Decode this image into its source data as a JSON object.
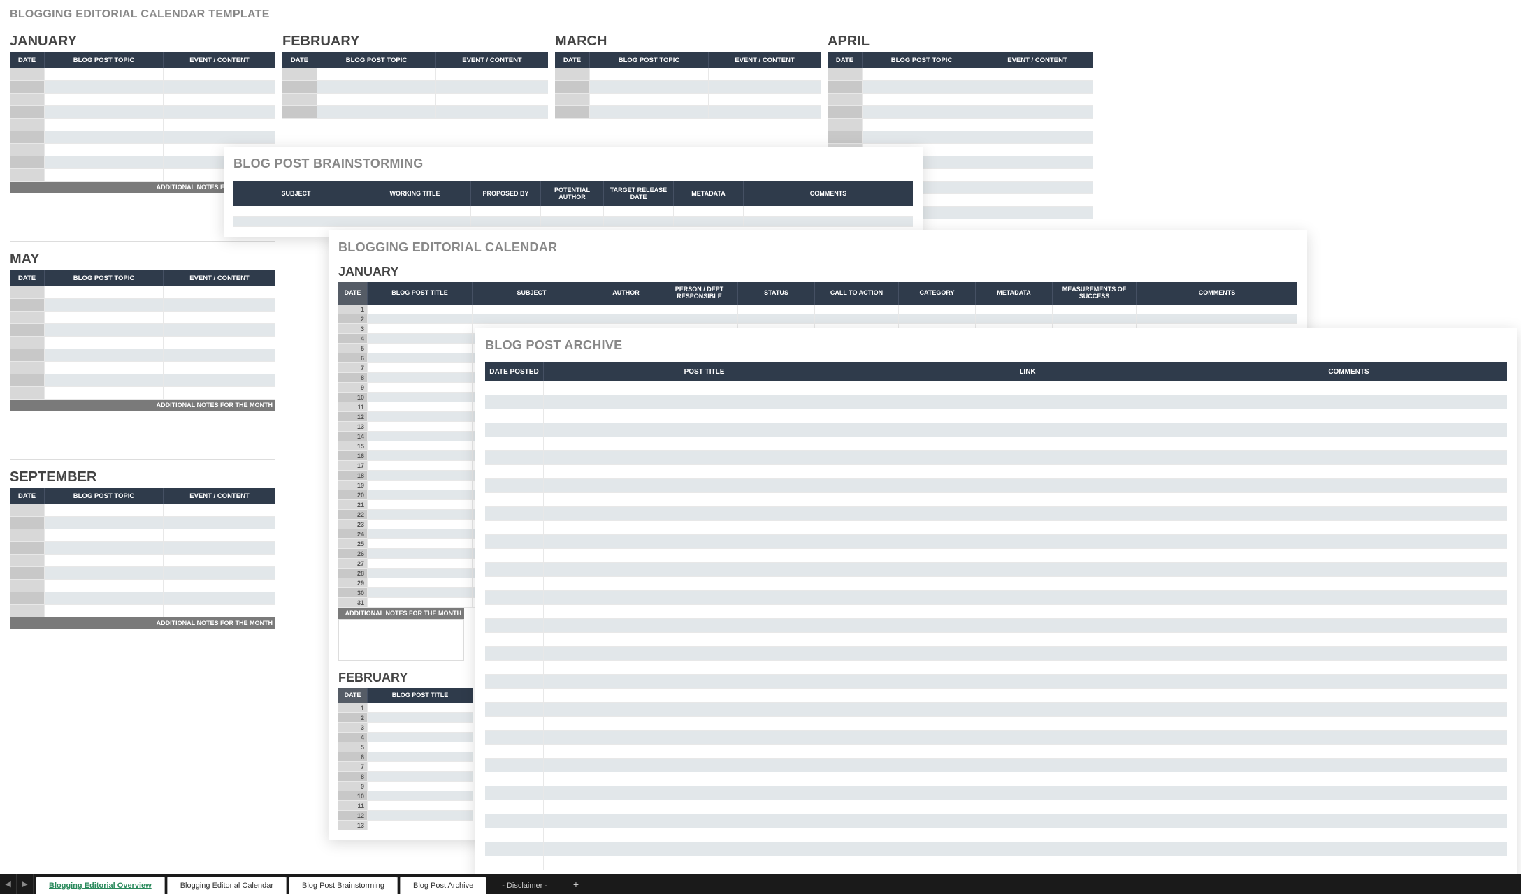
{
  "layer1": {
    "title": "BLOGGING EDITORIAL CALENDAR TEMPLATE",
    "columns": [
      "DATE",
      "BLOG POST TOPIC",
      "EVENT / CONTENT"
    ],
    "notes_label": "ADDITIONAL NOTES FOR THE MONTH",
    "months_row1": [
      "JANUARY",
      "FEBRUARY",
      "MARCH",
      "APRIL"
    ],
    "months_row2": [
      "MAY"
    ],
    "months_row3": [
      "SEPTEMBER"
    ]
  },
  "layer2": {
    "title": "BLOG POST BRAINSTORMING",
    "columns": [
      "SUBJECT",
      "WORKING TITLE",
      "PROPOSED BY",
      "POTENTIAL AUTHOR",
      "TARGET RELEASE DATE",
      "METADATA",
      "COMMENTS"
    ]
  },
  "layer3": {
    "title": "BLOGGING EDITORIAL CALENDAR",
    "month1": "JANUARY",
    "month2": "FEBRUARY",
    "columns": [
      "DATE",
      "BLOG POST TITLE",
      "SUBJECT",
      "AUTHOR",
      "PERSON / DEPT RESPONSIBLE",
      "STATUS",
      "CALL TO ACTION",
      "CATEGORY",
      "METADATA",
      "MEASUREMENTS OF SUCCESS",
      "COMMENTS"
    ],
    "notes_label": "ADDITIONAL NOTES FOR THE MONTH"
  },
  "layer4": {
    "title": "BLOG POST ARCHIVE",
    "columns": [
      "DATE POSTED",
      "POST TITLE",
      "LINK",
      "COMMENTS"
    ]
  },
  "tabs": {
    "t1": "Blogging Editorial Overview",
    "t2": "Blogging Editorial Calendar",
    "t3": "Blog Post Brainstorming",
    "t4": "Blog Post Archive",
    "t5": "- Disclaimer -"
  }
}
